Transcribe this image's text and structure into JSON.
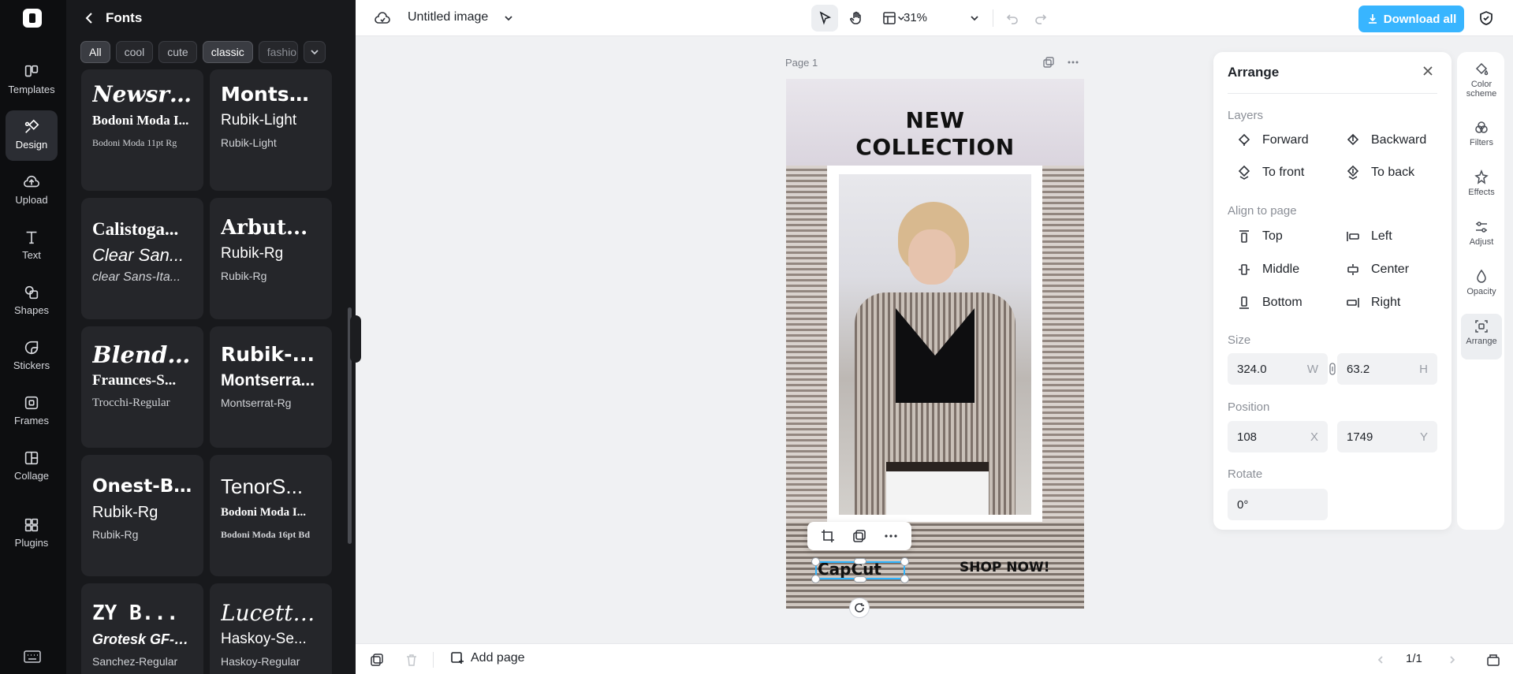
{
  "rail": {
    "items": [
      {
        "label": "Templates",
        "icon": "templates-icon"
      },
      {
        "label": "Design",
        "icon": "design-icon"
      },
      {
        "label": "Upload",
        "icon": "upload-icon"
      },
      {
        "label": "Text",
        "icon": "text-icon"
      },
      {
        "label": "Shapes",
        "icon": "shapes-icon"
      },
      {
        "label": "Stickers",
        "icon": "stickers-icon"
      },
      {
        "label": "Frames",
        "icon": "frames-icon"
      },
      {
        "label": "Collage",
        "icon": "collage-icon"
      },
      {
        "label": "Plugins",
        "icon": "plugins-icon"
      }
    ],
    "active": "Design"
  },
  "panel": {
    "title": "Fonts",
    "chips": [
      "All",
      "cool",
      "cute",
      "classic",
      "fashio"
    ],
    "selected_chip": "classic",
    "cards": [
      {
        "l1": "Newsre...",
        "l2": "Bodoni Moda I...",
        "l3": "Bodoni Moda 11pt Rg"
      },
      {
        "l1": "Montse...",
        "l2": "Rubik-Light",
        "l3": "Rubik-Light"
      },
      {
        "l1": "Calistoga...",
        "l2": "Clear San...",
        "l3": "clear Sans-Ita..."
      },
      {
        "l1": "Arbut...",
        "l2": "Rubik-Rg",
        "l3": "Rubik-Rg"
      },
      {
        "l1": "Blenda...",
        "l2": "Fraunces-S...",
        "l3": "Trocchi-Regular"
      },
      {
        "l1": "Rubik-...",
        "l2": "Montserra...",
        "l3": "Montserrat-Rg"
      },
      {
        "l1": "Onest-Bl...",
        "l2": "Rubik-Rg",
        "l3": "Rubik-Rg"
      },
      {
        "l1": "TenorS...",
        "l2": "Bodoni Moda I...",
        "l3": "Bodoni Moda 16pt Bd"
      },
      {
        "l1": "ZY B...",
        "l2": "Grotesk GF-B...",
        "l3": "Sanchez-Regular"
      },
      {
        "l1": "Lucette...",
        "l2": "Haskoy-Se...",
        "l3": "Haskoy-Regular"
      }
    ]
  },
  "topbar": {
    "doc_name": "Untitled image",
    "zoom": "31%",
    "download_label": "Download all"
  },
  "canvas": {
    "page_label": "Page 1",
    "headline_1": "NEW",
    "headline_2": "COLLECTION",
    "shop_text": "SHOP NOW!",
    "brand_text": "CapCut"
  },
  "arrange": {
    "title": "Arrange",
    "layers_label": "Layers",
    "forward": "Forward",
    "backward": "Backward",
    "to_front": "To front",
    "to_back": "To back",
    "align_label": "Align to page",
    "top": "Top",
    "left": "Left",
    "middle": "Middle",
    "center": "Center",
    "bottom": "Bottom",
    "right": "Right",
    "size_label": "Size",
    "width": "324.0",
    "width_unit": "W",
    "height": "63.2",
    "height_unit": "H",
    "position_label": "Position",
    "pos_x": "108",
    "x_unit": "X",
    "pos_y": "1749",
    "y_unit": "Y",
    "rotate_label": "Rotate",
    "rotate": "0°"
  },
  "tools": [
    {
      "label": "Color scheme"
    },
    {
      "label": "Filters"
    },
    {
      "label": "Effects"
    },
    {
      "label": "Adjust"
    },
    {
      "label": "Opacity"
    },
    {
      "label": "Arrange"
    }
  ],
  "bottombar": {
    "add_page": "Add page",
    "page_count": "1/1"
  },
  "colors": {
    "accent": "#38b5ff",
    "selection": "#2fb4ff",
    "rail_bg": "#0d0e10",
    "panel_bg": "#18191c"
  }
}
